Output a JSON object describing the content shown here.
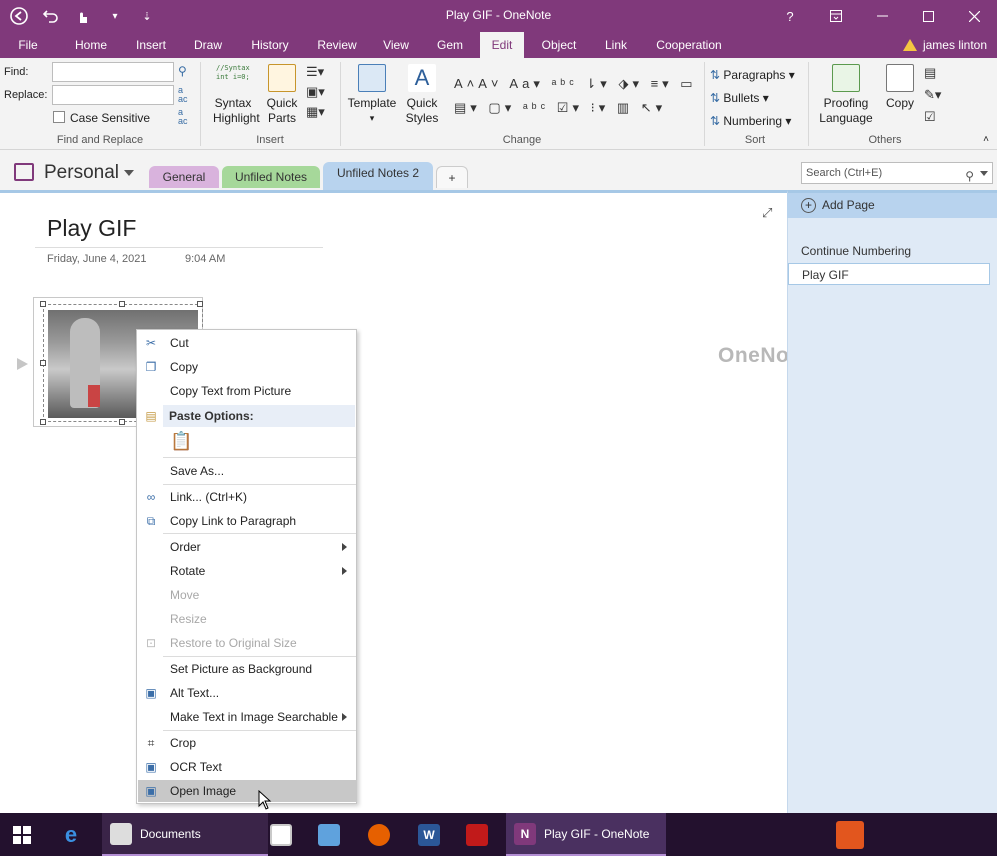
{
  "window": {
    "title": "Play GIF - OneNote",
    "help": "?",
    "controls": [
      "restore-ribbon",
      "minimize",
      "maximize",
      "close"
    ]
  },
  "menu": {
    "tabs": [
      "File",
      "Home",
      "Insert",
      "Draw",
      "History",
      "Review",
      "View",
      "Gem",
      "Edit",
      "Object",
      "Link",
      "Cooperation"
    ],
    "active": "Edit",
    "user": "james linton"
  },
  "ribbon": {
    "find_label": "Find:",
    "replace_label": "Replace:",
    "case_sensitive": "Case Sensitive",
    "group_find": "Find and Replace",
    "syntax_highlight": "Syntax Highlight",
    "syntax_snippet": "//Syntax int i=0;",
    "quick_parts": "Quick Parts",
    "group_insert": "Insert",
    "template": "Template",
    "quick_styles": "Quick Styles",
    "group_change": "Change",
    "paragraphs": "Paragraphs",
    "bullets": "Bullets",
    "numbering": "Numbering",
    "group_sort": "Sort",
    "proofing_language": "Proofing Language",
    "copy": "Copy",
    "group_others": "Others"
  },
  "notebook": {
    "name": "Personal",
    "sections": [
      {
        "label": "General",
        "color": "#d9b3dd"
      },
      {
        "label": "Unfiled Notes",
        "color": "#a6d89a"
      },
      {
        "label": "Unfiled Notes 2",
        "color": "#b8d3ee"
      }
    ],
    "add_section": "+",
    "search_placeholder": "Search (Ctrl+E)"
  },
  "page": {
    "title": "Play GIF",
    "date": "Friday, June 4, 2021",
    "time": "9:04 AM",
    "watermark": "OneNoteGem.com"
  },
  "context_menu": {
    "items": [
      {
        "label": "Cut",
        "icon": "scissors-icon"
      },
      {
        "label": "Copy",
        "icon": "copy-icon"
      },
      {
        "label": "Copy Text from Picture",
        "icon": ""
      },
      {
        "label": "Save As...",
        "icon": ""
      },
      {
        "label": "Link...  (Ctrl+K)",
        "icon": "link-icon"
      },
      {
        "label": "Copy Link to Paragraph",
        "icon": "copy-link-icon"
      },
      {
        "label": "Order",
        "icon": "",
        "submenu": true
      },
      {
        "label": "Rotate",
        "icon": "",
        "submenu": true
      },
      {
        "label": "Move",
        "icon": "",
        "disabled": true
      },
      {
        "label": "Resize",
        "icon": "",
        "disabled": true
      },
      {
        "label": "Restore to Original Size",
        "icon": "restore-size-icon",
        "disabled": true
      },
      {
        "label": "Set Picture as Background",
        "icon": ""
      },
      {
        "label": "Alt Text...",
        "icon": "alt-text-icon"
      },
      {
        "label": "Make Text in Image Searchable",
        "icon": "",
        "submenu": true
      },
      {
        "label": "Crop",
        "icon": "crop-icon"
      },
      {
        "label": "OCR Text",
        "icon": "ocr-icon"
      },
      {
        "label": "Open Image",
        "icon": "open-image-icon",
        "hover": true
      }
    ],
    "paste_options": "Paste Options:"
  },
  "pages_pane": {
    "add_page": "Add Page",
    "pages": [
      "Continue Numbering",
      "Play GIF"
    ],
    "selected": "Play GIF"
  },
  "taskbar": {
    "documents": "Documents",
    "onenote": "Play GIF - OneNote"
  },
  "colors": {
    "accent": "#80397b",
    "ribbon": "#f3f3f3",
    "pane": "#dfeaf6"
  }
}
